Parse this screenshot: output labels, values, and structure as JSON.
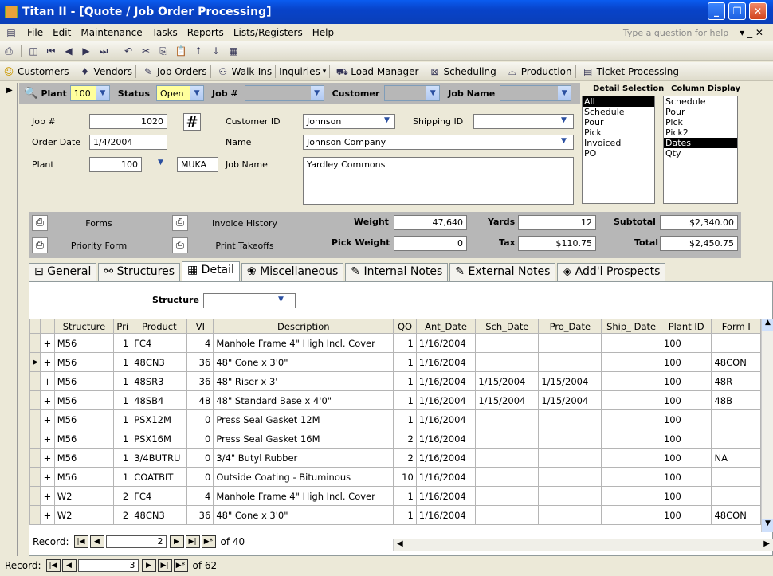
{
  "window": {
    "title": "Titan II - [Quote / Job Order Processing]"
  },
  "menu": [
    "File",
    "Edit",
    "Maintenance",
    "Tasks",
    "Reports",
    "Lists/Registers",
    "Help"
  ],
  "help_placeholder": "Type a question for help",
  "nav_toolbar": [
    "Customers",
    "Vendors",
    "Job Orders",
    "Walk-Ins",
    "Inquiries",
    "Load Manager",
    "Scheduling",
    "Production",
    "Ticket Processing"
  ],
  "filter": {
    "plant_label": "Plant",
    "plant_value": "100",
    "status_label": "Status",
    "status_value": "Open",
    "job_label": "Job #",
    "customer_label": "Customer",
    "jobname_label": "Job Name"
  },
  "detail_selection": {
    "title": "Detail Selection",
    "items": [
      "All",
      "Schedule",
      "Pour",
      "Pick",
      "Invoiced",
      "PO"
    ],
    "selected": "All"
  },
  "column_display": {
    "title": "Column Display",
    "items": [
      "Schedule",
      "Pour",
      "Pick",
      "Pick2",
      "Dates",
      "Qty"
    ],
    "selected": "Dates"
  },
  "order": {
    "job_label": "Job #",
    "job_value": "1020",
    "hash": "#",
    "date_label": "Order Date",
    "date_value": "1/4/2004",
    "plant_label": "Plant",
    "plant_value": "100",
    "plant_code": "MUKA",
    "customer_id_label": "Customer ID",
    "customer_id_value": "Johnson",
    "shipping_label": "Shipping ID",
    "name_label": "Name",
    "name_value": "Johnson Company",
    "jobname_label": "Job Name",
    "jobname_value": "Yardley Commons"
  },
  "buttons": {
    "forms": "Forms",
    "invoice_history": "Invoice History",
    "priority_form": "Priority Form",
    "print_takeoffs": "Print Takeoffs"
  },
  "totals": {
    "weight_label": "Weight",
    "weight": "47,640",
    "yards_label": "Yards",
    "yards": "12",
    "subtotal_label": "Subtotal",
    "subtotal": "$2,340.00",
    "pickweight_label": "Pick Weight",
    "pickweight": "0",
    "tax_label": "Tax",
    "tax": "$110.75",
    "total_label": "Total",
    "total": "$2,450.75"
  },
  "tabs": [
    "General",
    "Structures",
    "Detail",
    "Miscellaneous",
    "Internal Notes",
    "External Notes",
    "Add'l Prospects"
  ],
  "structure_label": "Structure",
  "grid": {
    "headers": [
      "Structure",
      "Pri",
      "Product",
      "VI",
      "Description",
      "QO",
      "Ant_Date",
      "Sch_Date",
      "Pro_Date",
      "Ship_ Date",
      "Plant ID",
      "Form I"
    ],
    "rows": [
      [
        "M56",
        "1",
        "FC4",
        "4",
        "Manhole Frame 4\" High Incl. Cover",
        "1",
        "1/16/2004",
        "",
        "",
        "",
        "100",
        ""
      ],
      [
        "M56",
        "1",
        "48CN3",
        "36",
        "48\" Cone x 3'0\"",
        "1",
        "1/16/2004",
        "",
        "",
        "",
        "100",
        "48CON"
      ],
      [
        "M56",
        "1",
        "48SR3",
        "36",
        "48\" Riser x 3'",
        "1",
        "1/16/2004",
        "1/15/2004",
        "1/15/2004",
        "",
        "100",
        "48R"
      ],
      [
        "M56",
        "1",
        "48SB4",
        "48",
        "48\" Standard Base x 4'0\"",
        "1",
        "1/16/2004",
        "1/15/2004",
        "1/15/2004",
        "",
        "100",
        "48B"
      ],
      [
        "M56",
        "1",
        "PSX12M",
        "0",
        "Press Seal Gasket 12M",
        "1",
        "1/16/2004",
        "",
        "",
        "",
        "100",
        ""
      ],
      [
        "M56",
        "1",
        "PSX16M",
        "0",
        "Press Seal Gasket 16M",
        "2",
        "1/16/2004",
        "",
        "",
        "",
        "100",
        ""
      ],
      [
        "M56",
        "1",
        "3/4BUTRU",
        "0",
        "3/4\" Butyl Rubber",
        "2",
        "1/16/2004",
        "",
        "",
        "",
        "100",
        "NA"
      ],
      [
        "M56",
        "1",
        "COATBIT",
        "0",
        "Outside Coating - Bituminous",
        "10",
        "1/16/2004",
        "",
        "",
        "",
        "100",
        ""
      ],
      [
        "W2",
        "2",
        "FC4",
        "4",
        "Manhole Frame 4\" High Incl. Cover",
        "1",
        "1/16/2004",
        "",
        "",
        "",
        "100",
        ""
      ],
      [
        "W2",
        "2",
        "48CN3",
        "36",
        "48\" Cone x 3'0\"",
        "1",
        "1/16/2004",
        "",
        "",
        "",
        "100",
        "48CON"
      ]
    ]
  },
  "inner_record": {
    "label": "Record:",
    "current": "2",
    "total": "of 40"
  },
  "outer_record": {
    "label": "Record:",
    "current": "3",
    "total": "of 62"
  }
}
